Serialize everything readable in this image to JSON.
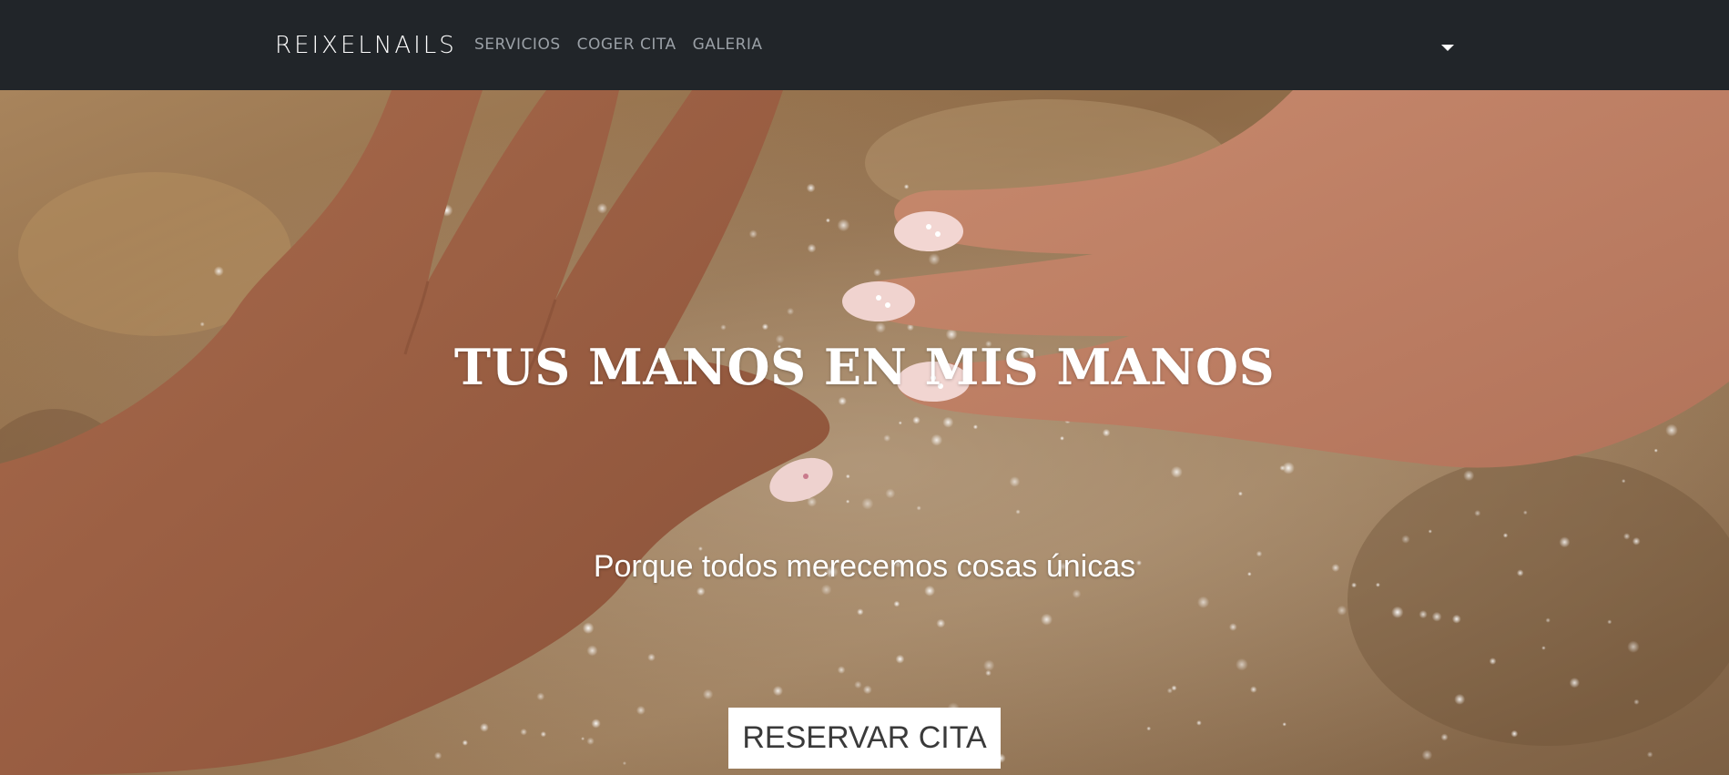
{
  "navbar": {
    "brand": "REIXELNAILS",
    "links": [
      {
        "label": "SERVICIOS"
      },
      {
        "label": "COGER CITA"
      },
      {
        "label": "GALERIA"
      }
    ]
  },
  "hero": {
    "title": "TUS MANOS EN MIS MANOS",
    "subtitle": "Porque todos merecemos cosas únicas",
    "cta_label": "RESERVAR CITA"
  },
  "colors": {
    "navbar_bg": "#212529",
    "nav_link": "#9aa0a6",
    "brand": "#ffffff",
    "cta_bg": "#ffffff",
    "cta_text": "#3a3a3a"
  }
}
